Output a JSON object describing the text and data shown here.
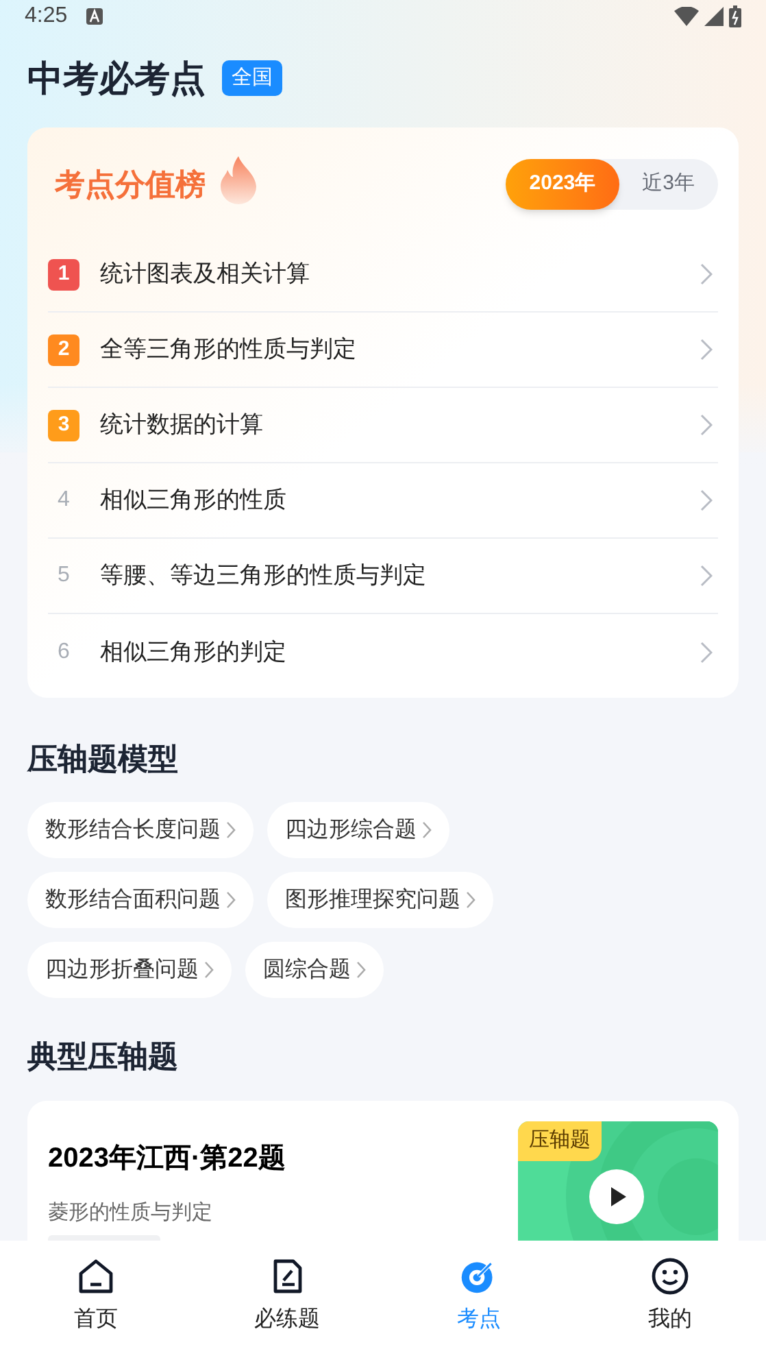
{
  "status_bar": {
    "time": "4:25"
  },
  "header": {
    "title": "中考必考点",
    "region_badge": "全国"
  },
  "ranking": {
    "title": "考点分值榜",
    "tabs": [
      {
        "label": "2023年",
        "selected": true
      },
      {
        "label": "近3年",
        "selected": false
      }
    ],
    "items": [
      {
        "rank": "1",
        "name": "统计图表及相关计算",
        "color": "#ef5350"
      },
      {
        "rank": "2",
        "name": "全等三角形的性质与判定",
        "color": "#ff8a1f"
      },
      {
        "rank": "3",
        "name": "统计数据的计算",
        "color": "#ff9c1a"
      },
      {
        "rank": "4",
        "name": "相似三角形的性质"
      },
      {
        "rank": "5",
        "name": "等腰、等边三角形的性质与判定"
      },
      {
        "rank": "6",
        "name": "相似三角形的判定"
      }
    ]
  },
  "models": {
    "title": "压轴题模型",
    "rows": [
      [
        "数形结合长度问题",
        "四边形综合题"
      ],
      [
        "数形结合面积问题",
        "图形推理探究问题"
      ],
      [
        "四边形折叠问题",
        "圆综合题"
      ]
    ]
  },
  "typical": {
    "title": "典型压轴题",
    "card": {
      "title": "2023年江西·第22题",
      "subtitle": "菱形的性质与判定",
      "badge": "压轴题"
    }
  },
  "nav": [
    {
      "label": "首页",
      "kind": "home",
      "selected": false
    },
    {
      "label": "必练题",
      "kind": "practice",
      "selected": false
    },
    {
      "label": "考点",
      "kind": "points",
      "selected": true
    },
    {
      "label": "我的",
      "kind": "me",
      "selected": false
    }
  ]
}
